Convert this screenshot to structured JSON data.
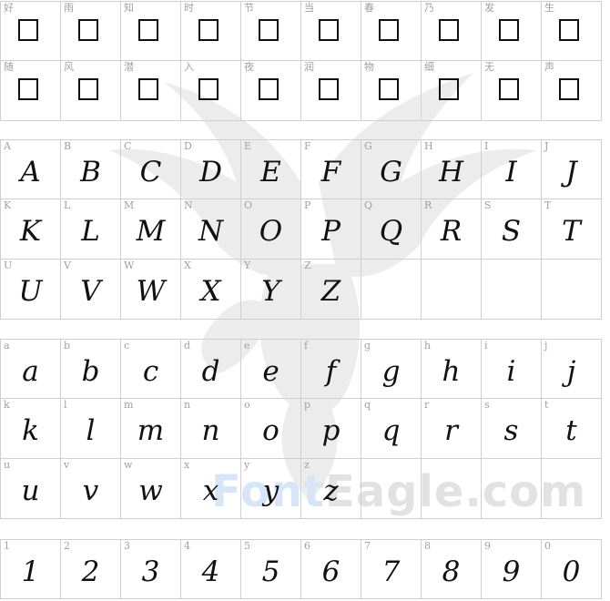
{
  "watermark": {
    "icon": "eagle-icon",
    "brand_prefix": "Font",
    "brand_suffix": "Eagle.com"
  },
  "cjk_rows": [
    [
      "好",
      "雨",
      "知",
      "时",
      "节",
      "当",
      "春",
      "乃",
      "发",
      "生"
    ],
    [
      "随",
      "风",
      "潜",
      "入",
      "夜",
      "润",
      "物",
      "细",
      "无",
      "声"
    ]
  ],
  "upper_rows": [
    [
      "A",
      "B",
      "C",
      "D",
      "E",
      "F",
      "G",
      "H",
      "I",
      "J"
    ],
    [
      "K",
      "L",
      "M",
      "N",
      "O",
      "P",
      "Q",
      "R",
      "S",
      "T"
    ],
    [
      "U",
      "V",
      "W",
      "X",
      "Y",
      "Z",
      "",
      "",
      "",
      ""
    ]
  ],
  "lower_rows": [
    [
      "a",
      "b",
      "c",
      "d",
      "e",
      "f",
      "g",
      "h",
      "i",
      "j"
    ],
    [
      "k",
      "l",
      "m",
      "n",
      "o",
      "p",
      "q",
      "r",
      "s",
      "t"
    ],
    [
      "u",
      "v",
      "w",
      "x",
      "y",
      "z",
      "",
      "",
      "",
      ""
    ]
  ],
  "digit_rows": [
    [
      "1",
      "2",
      "3",
      "4",
      "5",
      "6",
      "7",
      "8",
      "9",
      "0"
    ]
  ]
}
